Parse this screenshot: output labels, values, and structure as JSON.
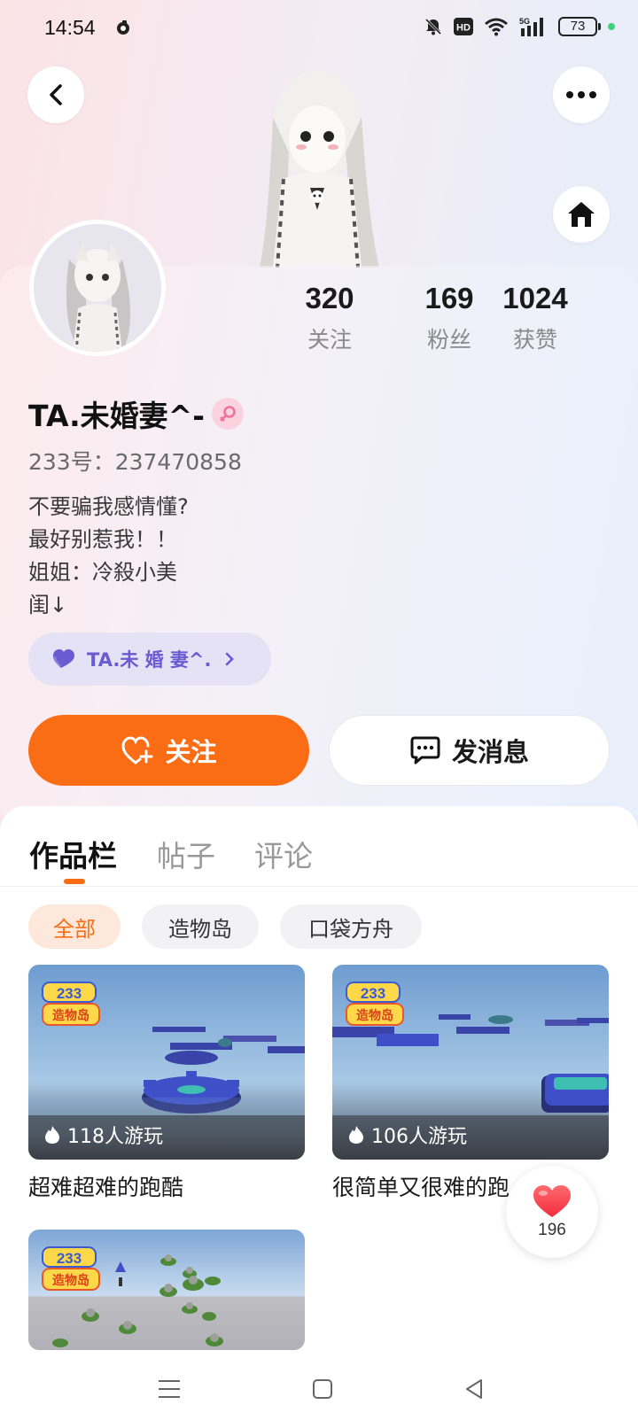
{
  "status_bar": {
    "time": "14:54",
    "battery": "73",
    "icons": [
      "silent-bell-icon",
      "hd-icon",
      "wifi-icon",
      "5g-signal-icon",
      "battery-icon"
    ]
  },
  "header": {
    "back_icon": "back-arrow-icon",
    "more_icon": "more-dots-icon",
    "home_icon": "home-icon"
  },
  "stats": {
    "following": {
      "value": "320",
      "label": "关注"
    },
    "fans": {
      "value": "169",
      "label": "粉丝"
    },
    "likes": {
      "value": "1024",
      "label": "获赞"
    }
  },
  "profile": {
    "username": "TA.未婚妻^-",
    "gender_icon": "female-icon",
    "user_id": "233号：237470858",
    "bio": [
      "不要骗我感情懂?",
      "最好别惹我！！",
      "姐姐：冷殺小美",
      "闺↓"
    ],
    "link_chip": {
      "label": "TA.未 婚 妻^.",
      "icon": "purple-heart-icon"
    }
  },
  "actions": {
    "follow_label": "关注",
    "message_label": "发消息"
  },
  "tabs": [
    {
      "label": "作品栏",
      "active": true
    },
    {
      "label": "帖子",
      "active": false
    },
    {
      "label": "评论",
      "active": false
    }
  ],
  "filters": [
    {
      "label": "全部",
      "active": true
    },
    {
      "label": "造物岛",
      "active": false
    },
    {
      "label": "口袋方舟",
      "active": false
    }
  ],
  "works": [
    {
      "title": "超难超难的跑酷",
      "plays": "118人游玩",
      "badge": "233 造物岛"
    },
    {
      "title": "很简单又很难的跑",
      "plays": "106人游玩",
      "badge": "233 造物岛"
    },
    {
      "title": "",
      "plays": "",
      "badge": "233 造物岛"
    }
  ],
  "like_float": {
    "count": "196",
    "icon": "heart-icon"
  },
  "nav": {
    "icons": [
      "menu-icon",
      "home-square-icon",
      "back-triangle-icon"
    ]
  },
  "colors": {
    "accent": "#fa6d14",
    "chip_purple": "#6a5bd2"
  }
}
